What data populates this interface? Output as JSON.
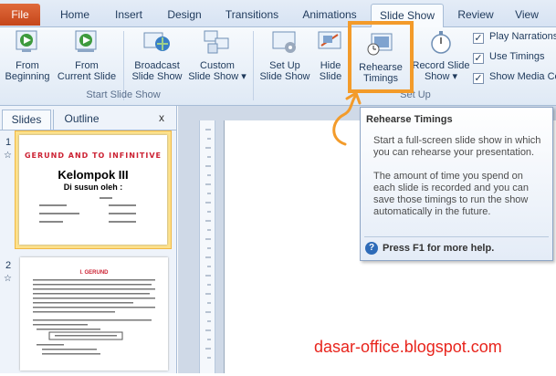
{
  "tabs": [
    "File",
    "Home",
    "Insert",
    "Design",
    "Transitions",
    "Animations",
    "Slide Show",
    "Review",
    "View"
  ],
  "active_tab": "Slide Show",
  "ribbon": {
    "start_group": {
      "label": "Start Slide Show",
      "from_beginning": [
        "From",
        "Beginning"
      ],
      "from_current": [
        "From",
        "Current Slide"
      ],
      "broadcast": [
        "Broadcast",
        "Slide Show"
      ],
      "custom": [
        "Custom",
        "Slide Show ▾"
      ]
    },
    "setup_group": {
      "label": "Set Up",
      "setup": [
        "Set Up",
        "Slide Show"
      ],
      "hide": [
        "Hide",
        "Slide"
      ],
      "rehearse": [
        "Rehearse",
        "Timings"
      ],
      "record": [
        "Record Slide",
        "Show ▾"
      ]
    },
    "checkboxes": [
      {
        "label": "Play Narrations",
        "checked": true
      },
      {
        "label": "Use Timings",
        "checked": true
      },
      {
        "label": "Show Media Co",
        "checked": true
      }
    ]
  },
  "panel": {
    "tab_slides": "Slides",
    "tab_outline": "Outline",
    "close": "x",
    "slide1_num": "1",
    "slide2_num": "2",
    "slide1": {
      "title": "GERUND AND TO INFINITIVE",
      "group": "Kelompok III",
      "byline": "Di susun oleh :"
    },
    "slide2": {
      "title": "I. GERUND"
    }
  },
  "tooltip": {
    "title": "Rehearse Timings",
    "para1": "Start a full-screen slide show in which you can rehearse your presentation.",
    "para2": "The amount of time you spend on each slide is recorded and you can save those timings to run the show automatically in the future.",
    "help": "Press F1 for more help."
  },
  "watermark": "dasar-office.blogspot.com",
  "colors": {
    "highlight": "#f39b2a",
    "file_tab": "#d0562a",
    "watermark": "#e8241c"
  }
}
